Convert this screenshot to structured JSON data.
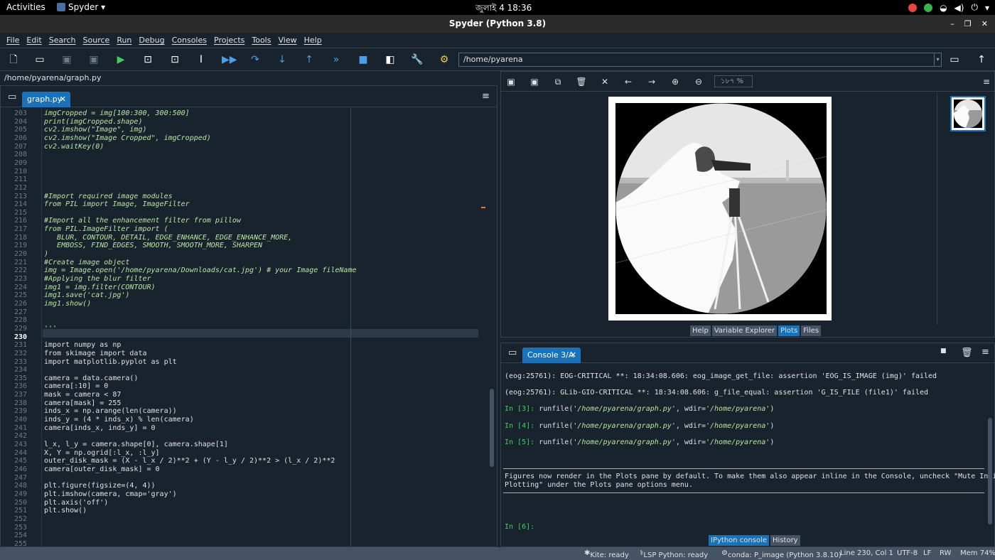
{
  "topbar": {
    "activities": "Activities",
    "app": "Spyder",
    "clock": "জুলাই 4  18:36"
  },
  "window": {
    "title": "Spyder (Python 3.8)"
  },
  "menu": [
    "File",
    "Edit",
    "Search",
    "Source",
    "Run",
    "Debug",
    "Consoles",
    "Projects",
    "Tools",
    "View",
    "Help"
  ],
  "toolbar": {
    "path": "/home/pyarena",
    "icons": [
      "new-file-icon",
      "open-file-icon",
      "save-icon",
      "save-all-icon",
      "run-icon",
      "run-cell-icon",
      "run-cell-advance-icon",
      "run-selection-icon",
      "debug-icon",
      "step-over-icon",
      "step-into-icon",
      "step-out-icon",
      "continue-icon",
      "stop-icon",
      "maximize-pane-icon",
      "preferences-icon",
      "python-path-icon"
    ]
  },
  "editor": {
    "filepath": "/home/pyarena/graph.py",
    "tab_label": "graph.py",
    "current_line": 230,
    "lines": [
      {
        "n": "203",
        "t": "imgCropped = img[100:300, 300:500]",
        "c": true
      },
      {
        "n": "204",
        "t": "print(imgCropped.shape)",
        "c": true
      },
      {
        "n": "205",
        "t": "cv2.imshow(\"Image\", img)",
        "c": true
      },
      {
        "n": "206",
        "t": "cv2.imshow(\"Image Cropped\", imgCropped)",
        "c": true
      },
      {
        "n": "207",
        "t": "cv2.waitKey(0)",
        "c": true
      },
      {
        "n": "208",
        "t": "",
        "c": false
      },
      {
        "n": "209",
        "t": "",
        "c": false
      },
      {
        "n": "210",
        "t": "",
        "c": false
      },
      {
        "n": "211",
        "t": "",
        "c": false
      },
      {
        "n": "212",
        "t": "",
        "c": false
      },
      {
        "n": "213",
        "t": "#Import required image modules",
        "c": true
      },
      {
        "n": "214",
        "t": "from PIL import Image, ImageFilter",
        "c": true
      },
      {
        "n": "215",
        "t": "",
        "c": false
      },
      {
        "n": "216",
        "t": "#Import all the enhancement filter from pillow",
        "c": true
      },
      {
        "n": "217",
        "t": "from PIL.ImageFilter import (",
        "c": true
      },
      {
        "n": "218",
        "t": "   BLUR, CONTOUR, DETAIL, EDGE_ENHANCE, EDGE_ENHANCE_MORE,",
        "c": true
      },
      {
        "n": "219",
        "t": "   EMBOSS, FIND_EDGES, SMOOTH, SMOOTH_MORE, SHARPEN",
        "c": true
      },
      {
        "n": "220",
        "t": ")",
        "c": true
      },
      {
        "n": "221",
        "t": "#Create image object",
        "c": true
      },
      {
        "n": "222",
        "t": "img = Image.open('/home/pyarena/Downloads/cat.jpg') # your Image fileName",
        "c": true
      },
      {
        "n": "223",
        "t": "#Applying the blur filter",
        "c": true
      },
      {
        "n": "224",
        "t": "img1 = img.filter(CONTOUR)",
        "c": true
      },
      {
        "n": "225",
        "t": "img1.save('cat.jpg')",
        "c": true
      },
      {
        "n": "226",
        "t": "img1.show()",
        "c": true
      },
      {
        "n": "227",
        "t": "",
        "c": false
      },
      {
        "n": "228",
        "t": "",
        "c": false
      },
      {
        "n": "229",
        "t": "'''",
        "c": true
      },
      {
        "n": "230",
        "t": "",
        "c": false
      },
      {
        "n": "231",
        "t": "import numpy as np",
        "c": false
      },
      {
        "n": "232",
        "t": "from skimage import data",
        "c": false
      },
      {
        "n": "233",
        "t": "import matplotlib.pyplot as plt",
        "c": false
      },
      {
        "n": "234",
        "t": "",
        "c": false
      },
      {
        "n": "235",
        "t": "camera = data.camera()",
        "c": false
      },
      {
        "n": "236",
        "t": "camera[:10] = 0",
        "c": false
      },
      {
        "n": "237",
        "t": "mask = camera < 87",
        "c": false
      },
      {
        "n": "238",
        "t": "camera[mask] = 255",
        "c": false
      },
      {
        "n": "239",
        "t": "inds_x = np.arange(len(camera))",
        "c": false
      },
      {
        "n": "240",
        "t": "inds_y = (4 * inds_x) % len(camera)",
        "c": false
      },
      {
        "n": "241",
        "t": "camera[inds_x, inds_y] = 0",
        "c": false
      },
      {
        "n": "242",
        "t": "",
        "c": false
      },
      {
        "n": "243",
        "t": "l_x, l_y = camera.shape[0], camera.shape[1]",
        "c": false
      },
      {
        "n": "244",
        "t": "X, Y = np.ogrid[:l_x, :l_y]",
        "c": false
      },
      {
        "n": "245",
        "t": "outer_disk_mask = (X - l_x / 2)**2 + (Y - l_y / 2)**2 > (l_x / 2)**2",
        "c": false
      },
      {
        "n": "246",
        "t": "camera[outer_disk_mask] = 0",
        "c": false
      },
      {
        "n": "247",
        "t": "",
        "c": false
      },
      {
        "n": "248",
        "t": "plt.figure(figsize=(4, 4))",
        "c": false
      },
      {
        "n": "249",
        "t": "plt.imshow(camera, cmap='gray')",
        "c": false
      },
      {
        "n": "250",
        "t": "plt.axis('off')",
        "c": false
      },
      {
        "n": "251",
        "t": "plt.show()",
        "c": false
      },
      {
        "n": "252",
        "t": "",
        "c": false
      },
      {
        "n": "253",
        "t": "",
        "c": false
      },
      {
        "n": "254",
        "t": "",
        "c": false
      },
      {
        "n": "255",
        "t": "",
        "c": false
      }
    ]
  },
  "plots": {
    "zoom": "১৮৭ %",
    "tabs": [
      "Help",
      "Variable Explorer",
      "Plots",
      "Files"
    ],
    "active_tab": "Plots"
  },
  "console": {
    "tab_label": "Console 3/A",
    "lines": [
      {
        "kind": "text",
        "text": "(eog:25761): EOG-CRITICAL **: 18:34:08.606: eog_image_get_file: assertion 'EOG_IS_IMAGE (img)' failed"
      },
      {
        "kind": "text",
        "text": "(eog:25761): GLib-GIO-CRITICAL **: 18:34:08.606: g_file_equal: assertion 'G_IS_FILE (file1)' failed"
      },
      {
        "kind": "run",
        "prompt": "In [3]: ",
        "pre": "runfile(",
        "s1": "'/home/pyarena/graph.py'",
        "mid": ", wdir=",
        "s2": "'/home/pyarena'",
        "post": ")"
      },
      {
        "kind": "run",
        "prompt": "In [4]: ",
        "pre": "runfile(",
        "s1": "'/home/pyarena/graph.py'",
        "mid": ", wdir=",
        "s2": "'/home/pyarena'",
        "post": ")"
      },
      {
        "kind": "run",
        "prompt": "In [5]: ",
        "pre": "runfile(",
        "s1": "'/home/pyarena/graph.py'",
        "mid": ", wdir=",
        "s2": "'/home/pyarena'",
        "post": ")"
      }
    ],
    "notice_line1": "Figures now render in the Plots pane by default. To make them also appear inline in the Console, uncheck \"Mute Inline",
    "notice_line2": "Plotting\" under the Plots pane options menu.",
    "last_prompt": "In [6]:",
    "tabs": [
      "IPython console",
      "History"
    ],
    "active_tab": "IPython console"
  },
  "status": {
    "kite": "Kite: ready",
    "lsp": "LSP Python: ready",
    "conda": "conda: P_image (Python 3.8.10)",
    "position": "Line 230, Col 1",
    "encoding": "UTF-8",
    "eol": "LF",
    "rw": "RW",
    "mem": "Mem 74%"
  }
}
